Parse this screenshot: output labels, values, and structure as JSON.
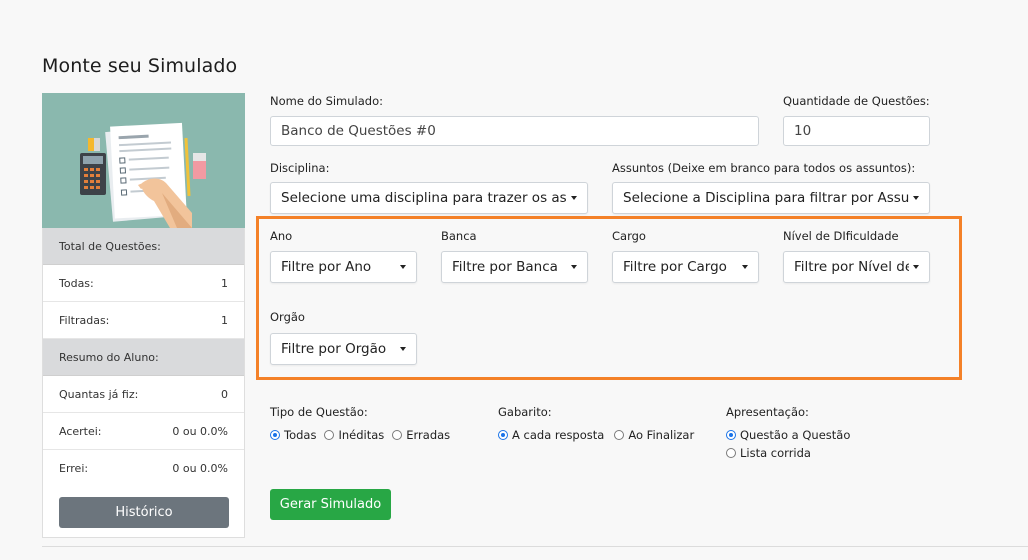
{
  "page_title": "Monte seu Simulado",
  "sidebar": {
    "total_header": "Total de Questões:",
    "todas_label": "Todas:",
    "todas_value": "1",
    "filtradas_label": "Filtradas:",
    "filtradas_value": "1",
    "resumo_header": "Resumo do Aluno:",
    "quantas_label": "Quantas já fiz:",
    "quantas_value": "0",
    "acertei_label": "Acertei:",
    "acertei_value": "0 ou 0.0%",
    "errei_label": "Errei:",
    "errei_value": "0 ou 0.0%",
    "historico_button": "Histórico"
  },
  "form": {
    "nome_label": "Nome do Simulado:",
    "nome_value": "Banco de Questões #0",
    "quantidade_label": "Quantidade de Questões:",
    "quantidade_value": "10",
    "disciplina_label": "Disciplina:",
    "disciplina_value": "Selecione uma disciplina para trazer os assuntos",
    "assuntos_label": "Assuntos (Deixe em branco para todos os assuntos):",
    "assuntos_value": "Selecione a Disciplina para filtrar por Assuntos",
    "ano_label": "Ano",
    "ano_value": "Filtre por Ano",
    "banca_label": "Banca",
    "banca_value": "Filtre por Banca",
    "cargo_label": "Cargo",
    "cargo_value": "Filtre por Cargo",
    "nivel_label": "Nível de DIficuldade",
    "nivel_value": "Filtre por Nível de Dificuldade",
    "orgao_label": "Orgão",
    "orgao_value": "Filtre por Orgão",
    "tipo_label": "Tipo de Questão:",
    "tipo_options": [
      "Todas",
      "Inéditas",
      "Erradas"
    ],
    "gabarito_label": "Gabarito:",
    "gabarito_options": [
      "A cada resposta",
      "Ao Finalizar"
    ],
    "apresentacao_label": "Apresentação:",
    "apresentacao_options": [
      "Questão a Questão",
      "Lista corrida"
    ],
    "gerar_button": "Gerar Simulado"
  },
  "colors": {
    "highlight": "#f48128",
    "primary_radio": "#1a73e8",
    "success": "#28a745",
    "secondary": "#6c757d",
    "illustration_bg": "#8ab8ae"
  },
  "icons": {
    "illustration": "exam-illustration",
    "caret": "caret-down-icon"
  }
}
